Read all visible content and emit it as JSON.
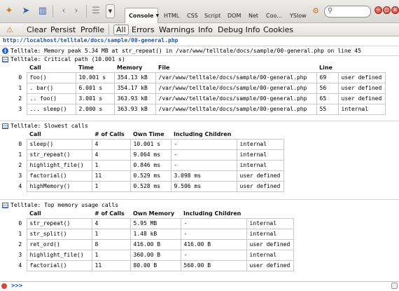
{
  "toolbar": {
    "tabs": [
      {
        "label": "Console"
      },
      {
        "label": "HTML"
      },
      {
        "label": "CSS"
      },
      {
        "label": "Script"
      },
      {
        "label": "DOM"
      },
      {
        "label": "Net"
      },
      {
        "label": "Coo..."
      },
      {
        "label": "YSlow"
      }
    ],
    "search_value": ""
  },
  "filter_bar": {
    "buttons": [
      "Clear",
      "Persist",
      "Profile"
    ],
    "filters": [
      "All",
      "Errors",
      "Warnings",
      "Info",
      "Debug Info",
      "Cookies"
    ],
    "active_filter": "All"
  },
  "console": {
    "url": "http://localhost/telltale/docs/sample/00-general.php",
    "info_message": "Telltale: Memory peak 5.34 MB at str_repeat() in /var/www/telltale/docs/sample/00-general.php on line 45",
    "critical": {
      "title": "Telltale: Critical path (10.001 s)",
      "headers": [
        "Call",
        "Time",
        "Memory",
        "File",
        "Line"
      ],
      "rows": [
        {
          "idx": "0",
          "call": "foo()",
          "time": "10.001 s",
          "memory": "354.13 kB",
          "file": "/var/www/telltale/docs/sample/00-general.php",
          "line": "69",
          "type": "user defined"
        },
        {
          "idx": "1",
          "call": ". bar()",
          "time": "6.001 s",
          "memory": "354.17 kB",
          "file": "/var/www/telltale/docs/sample/00-general.php",
          "line": "56",
          "type": "user defined"
        },
        {
          "idx": "2",
          "call": ".. foo()",
          "time": "3.001 s",
          "memory": "363.93 kB",
          "file": "/var/www/telltale/docs/sample/00-general.php",
          "line": "65",
          "type": "user defined"
        },
        {
          "idx": "3",
          "call": "... sleep()",
          "time": "2.000 s",
          "memory": "363.93 kB",
          "file": "/var/www/telltale/docs/sample/00-general.php",
          "line": "55",
          "type": "internal"
        }
      ]
    },
    "slowest": {
      "title": "Telltale: Slowest calls",
      "headers": [
        "Call",
        "# of Calls",
        "Own Time",
        "Including Children"
      ],
      "rows": [
        {
          "idx": "0",
          "call": "sleep()",
          "calls": "4",
          "own": "10.001 s",
          "incl": "-",
          "type": "internal"
        },
        {
          "idx": "1",
          "call": "str_repeat()",
          "calls": "4",
          "own": "9.064 ms",
          "incl": "-",
          "type": "internal"
        },
        {
          "idx": "2",
          "call": "highlight_file()",
          "calls": "1",
          "own": "0.846 ms",
          "incl": "-",
          "type": "internal"
        },
        {
          "idx": "3",
          "call": "factorial()",
          "calls": "11",
          "own": "0.529 ms",
          "incl": "3.098 ms",
          "type": "user defined"
        },
        {
          "idx": "4",
          "call": "highMemory()",
          "calls": "1",
          "own": "0.528 ms",
          "incl": "9.506 ms",
          "type": "user defined"
        }
      ]
    },
    "memory": {
      "title": "Telltale: Top memory usage calls",
      "headers": [
        "Call",
        "# of Calls",
        "Own Memory",
        "Including Children"
      ],
      "rows": [
        {
          "idx": "0",
          "call": "str_repeat()",
          "calls": "4",
          "own": "5.95 MB",
          "incl": "-",
          "type": "internal"
        },
        {
          "idx": "1",
          "call": "str_split()",
          "calls": "1",
          "own": "1.48 kB",
          "incl": "-",
          "type": "internal"
        },
        {
          "idx": "2",
          "call": "ret_ord()",
          "calls": "8",
          "own": "416.00 B",
          "incl": "416.00 B",
          "type": "user defined"
        },
        {
          "idx": "3",
          "call": "highlight_file()",
          "calls": "1",
          "own": "360.00 B",
          "incl": "-",
          "type": "internal"
        },
        {
          "idx": "4",
          "call": "factorial()",
          "calls": "11",
          "own": "80.00 B",
          "incl": "560.00 B",
          "type": "user defined"
        }
      ]
    }
  },
  "command_line": {
    "prompt": ">>>"
  }
}
